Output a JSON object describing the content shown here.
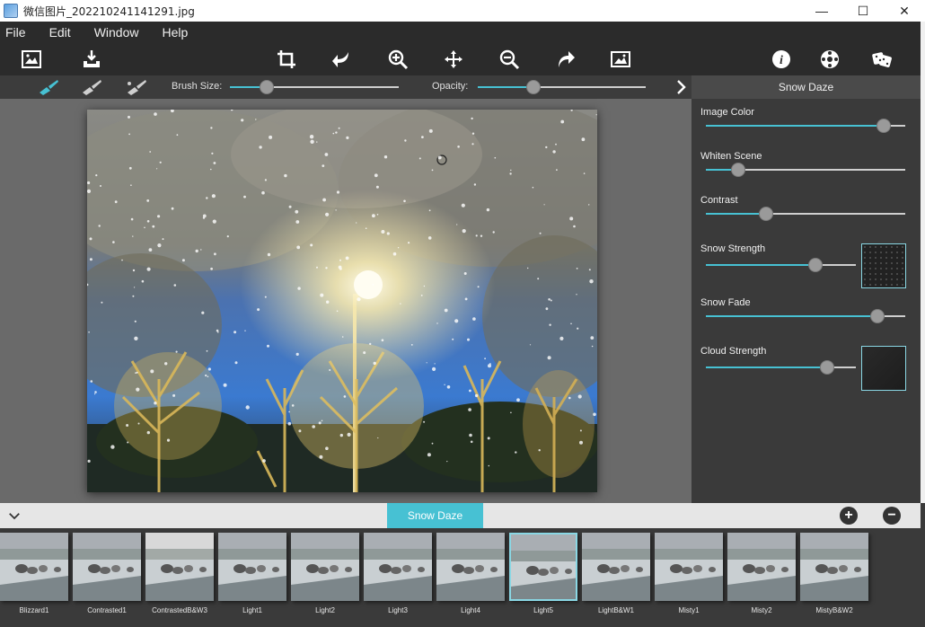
{
  "window": {
    "title": "微信图片_202210241141291.jpg",
    "minimize_glyph": "—",
    "maximize_glyph": "☐",
    "close_glyph": "✕"
  },
  "menu": [
    "File",
    "Edit",
    "Window",
    "Help"
  ],
  "toolbar": {
    "icons": [
      "open-image-icon",
      "save-icon",
      "crop-icon",
      "undo-icon",
      "zoom-in-icon",
      "move-icon",
      "zoom-out-icon",
      "redo-icon",
      "fit-screen-icon",
      "info-icon",
      "effects-icon",
      "random-icon"
    ]
  },
  "brushbar": {
    "brush_size_label": "Brush Size:",
    "brush_size_value": 0.22,
    "opacity_label": "Opacity:",
    "opacity_value": 0.33
  },
  "panel": {
    "title": "Snow Daze",
    "controls": [
      {
        "label": "Image Color",
        "value": 0.89
      },
      {
        "label": "Whiten Scene",
        "value": 0.16
      },
      {
        "label": "Contrast",
        "value": 0.3
      },
      {
        "label": "Snow Strength",
        "value": 0.73
      },
      {
        "label": "Snow Fade",
        "value": 0.86
      },
      {
        "label": "Cloud Strength",
        "value": 0.81
      }
    ]
  },
  "presetbar": {
    "active": "Snow Daze",
    "add_glyph": "+",
    "remove_glyph": "−",
    "collapse_glyph": "⌄"
  },
  "presets": [
    {
      "label": "Blizzard1",
      "selected": false
    },
    {
      "label": "Contrasted1",
      "selected": false
    },
    {
      "label": "ContrastedB&W3",
      "selected": false
    },
    {
      "label": "Light1",
      "selected": false
    },
    {
      "label": "Light2",
      "selected": false
    },
    {
      "label": "Light3",
      "selected": false
    },
    {
      "label": "Light4",
      "selected": false
    },
    {
      "label": "Light5",
      "selected": true
    },
    {
      "label": "LightB&W1",
      "selected": false
    },
    {
      "label": "Misty1",
      "selected": false
    },
    {
      "label": "Misty2",
      "selected": false
    },
    {
      "label": "MistyB&W2",
      "selected": false
    }
  ],
  "colors": {
    "accent": "#47c1d3",
    "panel": "#3a3a3a",
    "workspace": "#6a6a6a"
  }
}
